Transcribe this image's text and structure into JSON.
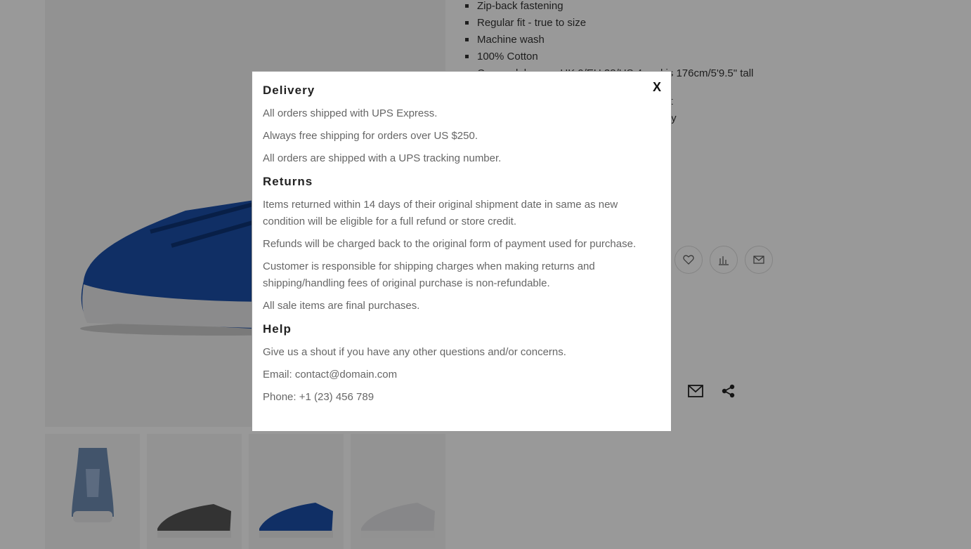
{
  "product": {
    "bullets": [
      "Zip-back fastening",
      "Regular fit - true to size",
      "Machine wash",
      "100% Cotton",
      "Our model wears UK 9/EU 38/US 4 and is 176cm/5'9.5\" tall"
    ],
    "description_line1": "Pair this navy and white striped v-neck t-shirt",
    "description_line2": "with denim and white kicks for a stylish sporty",
    "action_icons": [
      "heart-icon",
      "compare-icon",
      "envelope-icon"
    ],
    "share_icons": [
      "mail-icon",
      "share-icon"
    ]
  },
  "modal": {
    "close_label": "X",
    "sections": [
      {
        "title": "Delivery",
        "paragraphs": [
          "All orders shipped with UPS Express.",
          "Always free shipping for orders over US $250.",
          "All orders are shipped with a UPS tracking number."
        ]
      },
      {
        "title": "Returns",
        "paragraphs": [
          "Items returned within 14 days of their original shipment date in same as new condition will be eligible for a full refund or store credit.",
          "Refunds will be charged back to the original form of payment used for purchase.",
          "Customer is responsible for shipping charges when making returns and shipping/handling fees of original purchase is non-refundable.",
          "All sale items are final purchases."
        ]
      },
      {
        "title": "Help",
        "paragraphs": [
          "Give us a shout if you have any other questions and/or concerns.",
          "Email: contact@domain.com",
          "Phone: +1 (23) 456 789"
        ]
      }
    ]
  },
  "colors": {
    "shoe_blue": "#1b4fa8",
    "overlay": "rgba(0,0,0,0.40)"
  }
}
